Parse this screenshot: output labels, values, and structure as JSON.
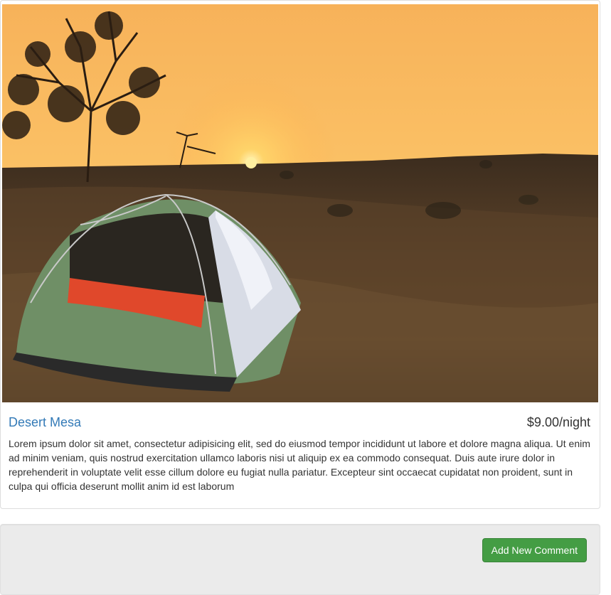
{
  "campground": {
    "image_alt": "Tent on a grassy hillside at sunset",
    "name": "Desert Mesa",
    "price": "$9.00/night",
    "description": "Lorem ipsum dolor sit amet, consectetur adipisicing elit, sed do eiusmod tempor incididunt ut labore et dolore magna aliqua. Ut enim ad minim veniam, quis nostrud exercitation ullamco laboris nisi ut aliquip ex ea commodo consequat. Duis aute irure dolor in reprehenderit in voluptate velit esse cillum dolore eu fugiat nulla pariatur. Excepteur sint occaecat cupidatat non proident, sunt in culpa qui officia deserunt mollit anim id est laborum"
  },
  "comments": {
    "add_button_label": "Add New Comment"
  },
  "colors": {
    "link": "#337ab7",
    "button_success": "#449d44",
    "well_background": "#ebebeb"
  }
}
